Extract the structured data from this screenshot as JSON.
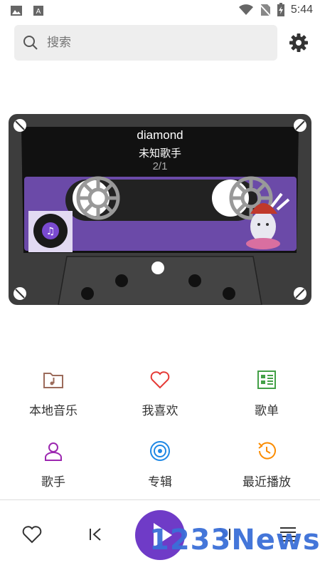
{
  "status": {
    "time": "5:44"
  },
  "search": {
    "placeholder": "搜索"
  },
  "now_playing": {
    "title": "diamond",
    "artist": "未知歌手",
    "position": "2/1"
  },
  "nav": [
    {
      "label": "本地音乐",
      "icon": "folder-music-icon",
      "color": "#9c6b5b"
    },
    {
      "label": "我喜欢",
      "icon": "heart-icon",
      "color": "#e53935"
    },
    {
      "label": "歌单",
      "icon": "playlist-icon",
      "color": "#43a047"
    },
    {
      "label": "歌手",
      "icon": "person-icon",
      "color": "#9c27b0"
    },
    {
      "label": "专辑",
      "icon": "album-icon",
      "color": "#1e88e5"
    },
    {
      "label": "最近播放",
      "icon": "history-icon",
      "color": "#fb8c00"
    }
  ],
  "controls": {
    "accent": "#6f3bc7"
  },
  "watermark": "1233News"
}
